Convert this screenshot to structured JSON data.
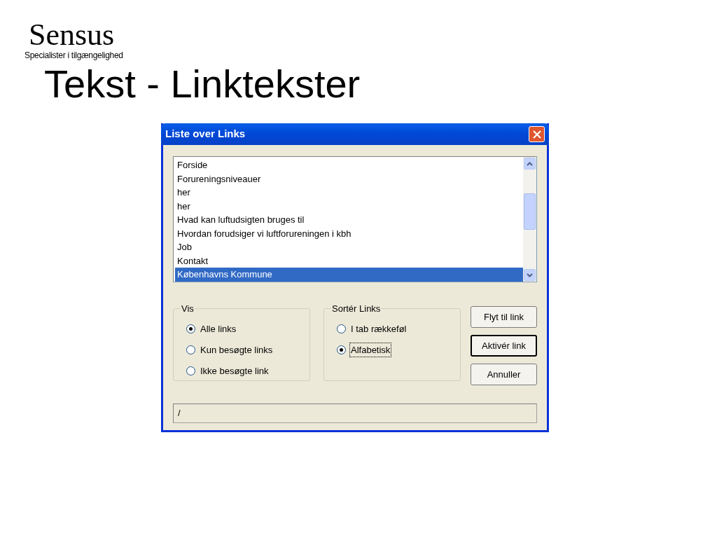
{
  "logo": {
    "name": "Sensus",
    "tagline": "Specialister i tilgængelighed"
  },
  "slide_title": "Tekst - Linktekster",
  "dialog": {
    "title": "Liste over Links",
    "links": [
      {
        "label": "Forside",
        "selected": false
      },
      {
        "label": "Forureningsniveauer",
        "selected": false
      },
      {
        "label": "her",
        "selected": false
      },
      {
        "label": "her",
        "selected": false
      },
      {
        "label": "Hvad kan luftudsigten bruges til",
        "selected": false
      },
      {
        "label": "Hvordan forudsiger vi luftforureningen i kbh",
        "selected": false
      },
      {
        "label": "Job",
        "selected": false
      },
      {
        "label": "Kontakt",
        "selected": false
      },
      {
        "label": "Københavns Kommune",
        "selected": true
      }
    ],
    "groups": [
      {
        "title": "Vis",
        "options": [
          {
            "label": "Alle links",
            "selected": true,
            "focused": false
          },
          {
            "label": "Kun besøgte links",
            "selected": false,
            "focused": false
          },
          {
            "label": "Ikke besøgte link",
            "selected": false,
            "focused": false
          }
        ]
      },
      {
        "title": "Sortér Links",
        "options": [
          {
            "label": "I tab rækkeføl",
            "selected": false,
            "focused": false
          },
          {
            "label": "Alfabetisk",
            "selected": true,
            "focused": true
          }
        ]
      }
    ],
    "buttons": [
      {
        "label": "Flyt til link",
        "default": false
      },
      {
        "label": "Aktivér link",
        "default": true
      },
      {
        "label": "Annuller",
        "default": false
      }
    ],
    "status": "/"
  }
}
